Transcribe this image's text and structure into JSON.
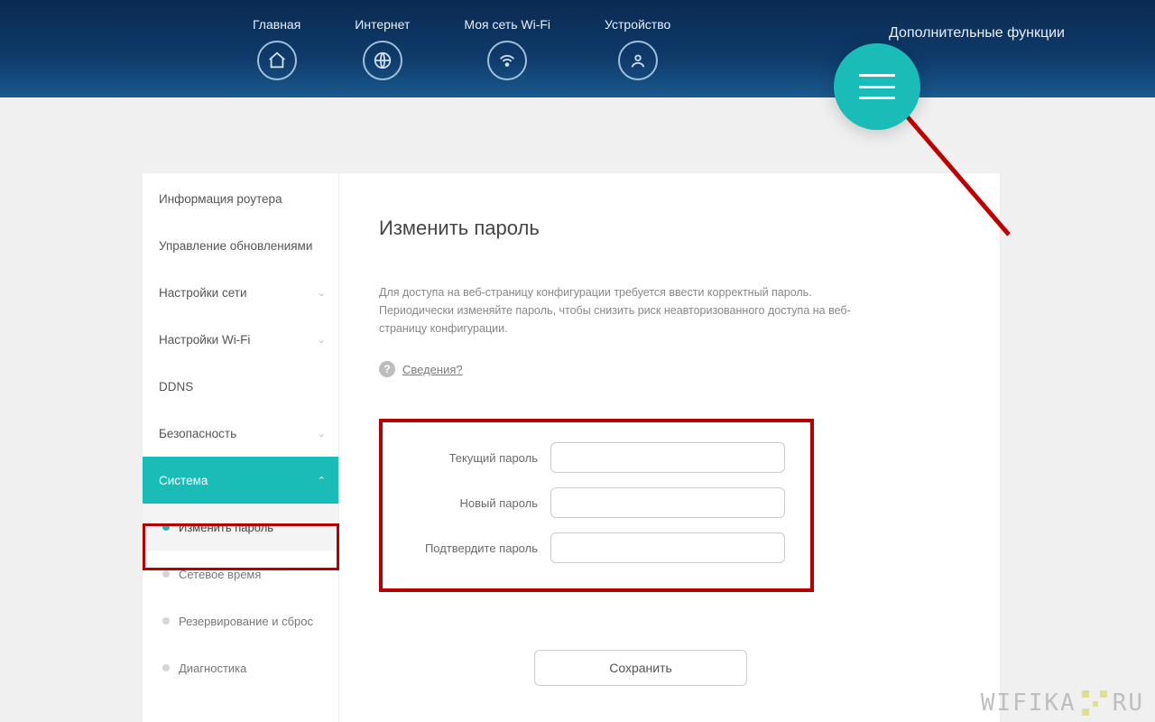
{
  "topnav": {
    "items": [
      {
        "label": "Главная",
        "icon": "home-icon"
      },
      {
        "label": "Интернет",
        "icon": "globe-icon"
      },
      {
        "label": "Моя сеть Wi-Fi",
        "icon": "wifi-icon"
      },
      {
        "label": "Устройство",
        "icon": "device-icon"
      }
    ],
    "extra_label": "Дополнительные функции"
  },
  "sidebar": {
    "items": [
      {
        "label": "Информация роутера",
        "expandable": false
      },
      {
        "label": "Управление обновлениями",
        "expandable": false
      },
      {
        "label": "Настройки сети",
        "expandable": true
      },
      {
        "label": "Настройки Wi-Fi",
        "expandable": true
      },
      {
        "label": "DDNS",
        "expandable": false
      },
      {
        "label": "Безопасность",
        "expandable": true
      },
      {
        "label": "Система",
        "expandable": true,
        "active": true
      }
    ],
    "subitems": [
      {
        "label": "Изменить пароль",
        "selected": true
      },
      {
        "label": "Сетевое время",
        "selected": false
      },
      {
        "label": "Резервирование и сброс",
        "selected": false
      },
      {
        "label": "Диагностика",
        "selected": false
      }
    ]
  },
  "content": {
    "title": "Изменить пароль",
    "description": "Для доступа на веб-страницу конфигурации требуется ввести корректный пароль. Периодически изменяйте пароль, чтобы снизить риск неавторизованного доступа на веб-страницу конфигурации.",
    "info_link": "Сведения?",
    "fields": {
      "current": {
        "label": "Текущий пароль",
        "value": ""
      },
      "new": {
        "label": "Новый пароль",
        "value": ""
      },
      "confirm": {
        "label": "Подтвердите пароль",
        "value": ""
      }
    },
    "save_label": "Сохранить"
  },
  "watermark": {
    "text_left": "WIFIKA",
    "text_right": "RU"
  }
}
